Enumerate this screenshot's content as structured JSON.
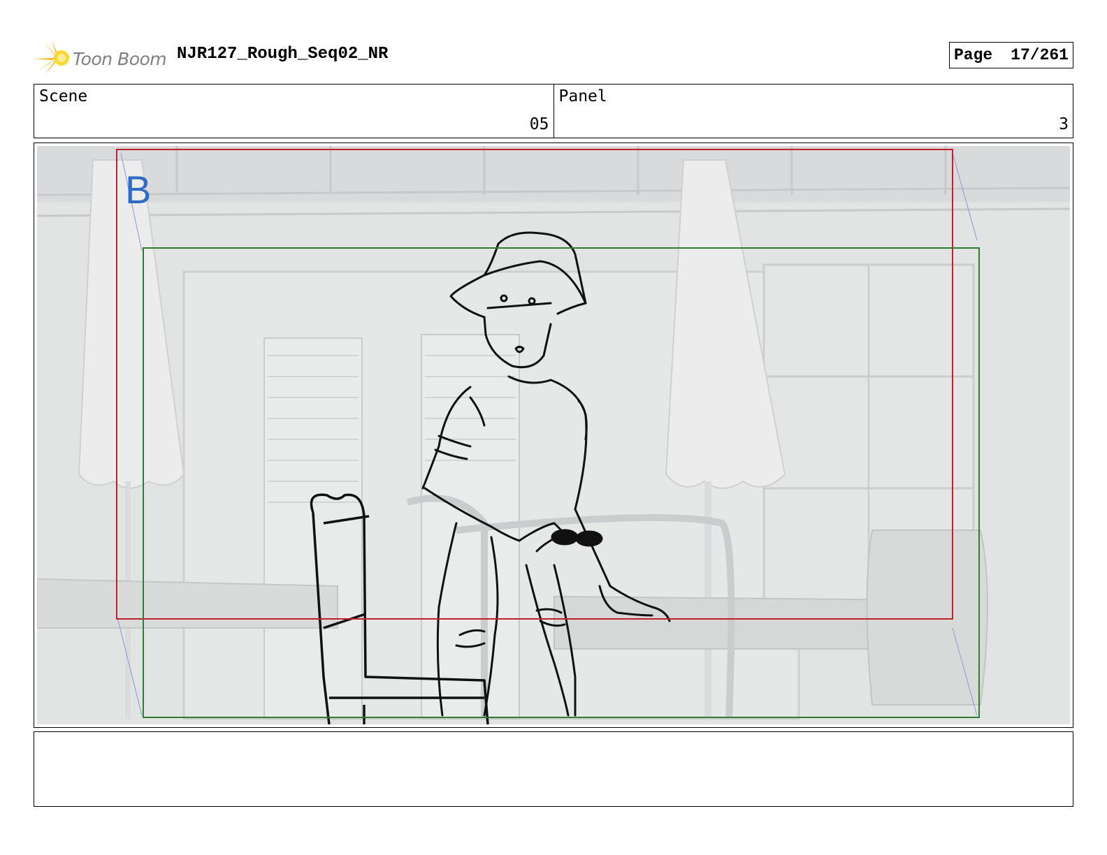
{
  "header": {
    "logo_text": "Toon Boom",
    "title": "NJR127_Rough_Seq02_NR",
    "page_label": "Page",
    "page_value": "17/261"
  },
  "scene": {
    "label": "Scene",
    "value": "05"
  },
  "panel": {
    "label": "Panel",
    "value": "3"
  },
  "frame": {
    "marker": "B"
  },
  "colors": {
    "safe_frame": "#c0202a",
    "camera_frame": "#2e7d32",
    "marker": "#2f6bc7"
  },
  "notes": {
    "text": ""
  }
}
